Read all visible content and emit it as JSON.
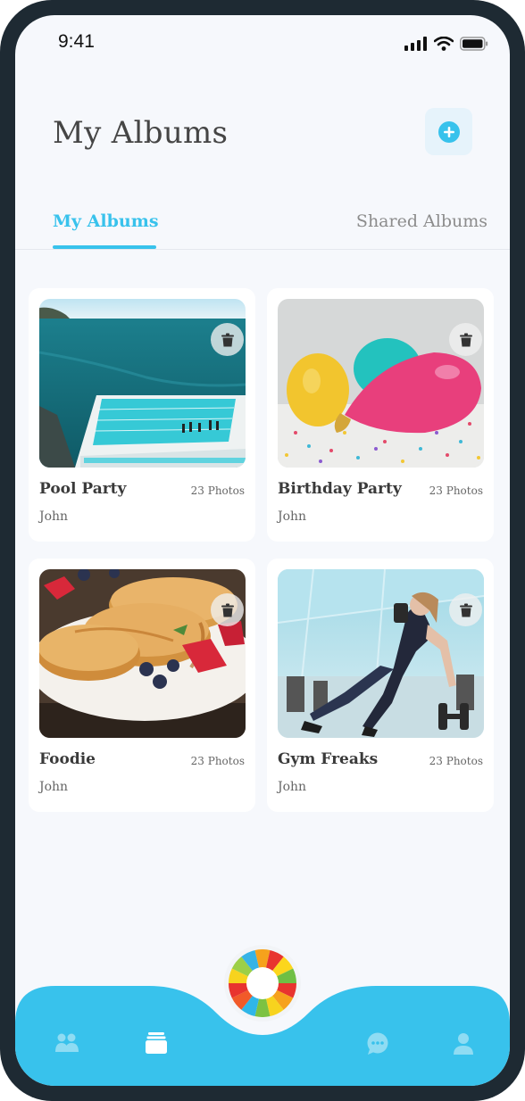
{
  "status_bar": {
    "time": "9:41"
  },
  "header": {
    "title": "My Albums",
    "add_icon": "plus-circle-icon"
  },
  "tabs": [
    {
      "label": "My Albums",
      "active": true
    },
    {
      "label": "Shared Albums",
      "active": false
    }
  ],
  "albums": [
    {
      "name": "Pool Party",
      "count": "23 Photos",
      "owner": "John",
      "image": "ocean-pool-photo"
    },
    {
      "name": "Birthday Party",
      "count": "23 Photos",
      "owner": "John",
      "image": "balloons-confetti-photo"
    },
    {
      "name": "Foodie",
      "count": "23 Photos",
      "owner": "John",
      "image": "pancakes-photo"
    },
    {
      "name": "Gym Freaks",
      "count": "23 Photos",
      "owner": "John",
      "image": "gym-workout-photo"
    }
  ],
  "bottom_nav": {
    "items": [
      "friends-icon",
      "albums-icon",
      "chat-icon",
      "profile-icon"
    ],
    "center": "camera-shutter-icon"
  },
  "colors": {
    "accent": "#38c2ec",
    "background": "#f6f8fc",
    "frame": "#1e2a33",
    "text": "#454545"
  }
}
